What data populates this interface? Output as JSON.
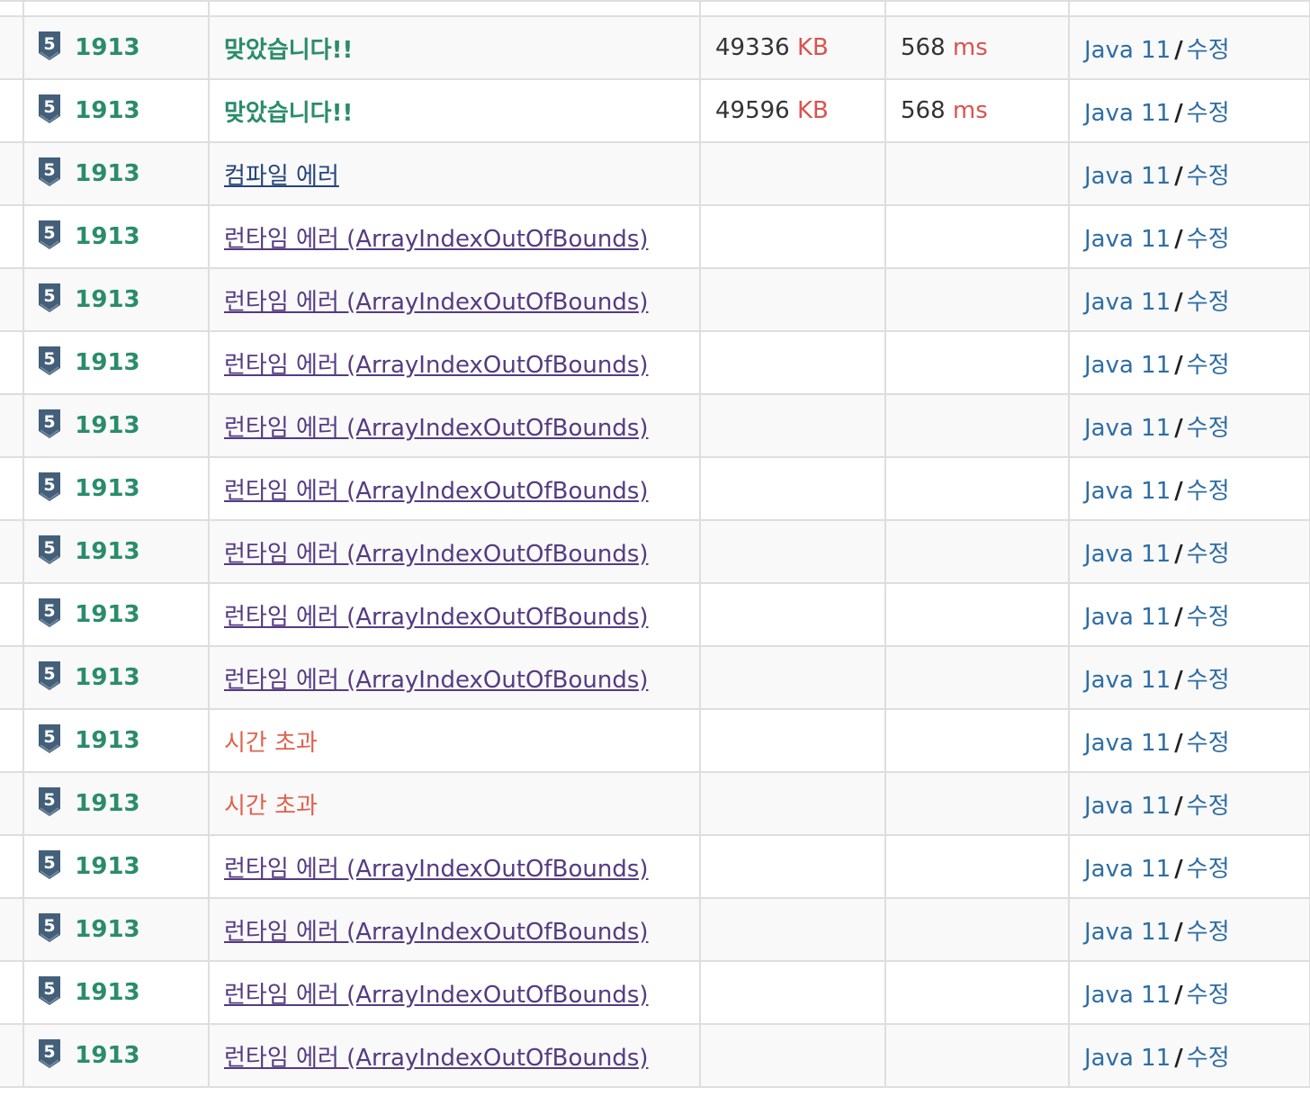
{
  "colors": {
    "accepted": "#2a8c6c",
    "link_purple": "#553b82",
    "compile_error": "#27457a",
    "time_limit": "#e0614e",
    "unit_red": "#d9534f",
    "lang_blue": "#2e6da4",
    "tier_icon": "#435f7a"
  },
  "rows": [
    {
      "tier": "5",
      "problem": "1913",
      "result": "맞았습니다!!",
      "result_type": "accepted",
      "memory": "49336",
      "memory_unit": "KB",
      "time": "568",
      "time_unit": "ms",
      "language": "Java 11",
      "separator": "/",
      "edit": "수정"
    },
    {
      "tier": "5",
      "problem": "1913",
      "result": "맞았습니다!!",
      "result_type": "accepted",
      "memory": "49596",
      "memory_unit": "KB",
      "time": "568",
      "time_unit": "ms",
      "language": "Java 11",
      "separator": "/",
      "edit": "수정"
    },
    {
      "tier": "5",
      "problem": "1913",
      "result": "컴파일 에러",
      "result_type": "compile-error",
      "memory": "",
      "memory_unit": "",
      "time": "",
      "time_unit": "",
      "language": "Java 11",
      "separator": "/",
      "edit": "수정"
    },
    {
      "tier": "5",
      "problem": "1913",
      "result": "런타임 에러 (ArrayIndexOutOfBounds)",
      "result_type": "runtime-error",
      "memory": "",
      "memory_unit": "",
      "time": "",
      "time_unit": "",
      "language": "Java 11",
      "separator": "/",
      "edit": "수정"
    },
    {
      "tier": "5",
      "problem": "1913",
      "result": "런타임 에러 (ArrayIndexOutOfBounds)",
      "result_type": "runtime-error",
      "memory": "",
      "memory_unit": "",
      "time": "",
      "time_unit": "",
      "language": "Java 11",
      "separator": "/",
      "edit": "수정"
    },
    {
      "tier": "5",
      "problem": "1913",
      "result": "런타임 에러 (ArrayIndexOutOfBounds)",
      "result_type": "runtime-error",
      "memory": "",
      "memory_unit": "",
      "time": "",
      "time_unit": "",
      "language": "Java 11",
      "separator": "/",
      "edit": "수정"
    },
    {
      "tier": "5",
      "problem": "1913",
      "result": "런타임 에러 (ArrayIndexOutOfBounds)",
      "result_type": "runtime-error",
      "memory": "",
      "memory_unit": "",
      "time": "",
      "time_unit": "",
      "language": "Java 11",
      "separator": "/",
      "edit": "수정"
    },
    {
      "tier": "5",
      "problem": "1913",
      "result": "런타임 에러 (ArrayIndexOutOfBounds)",
      "result_type": "runtime-error",
      "memory": "",
      "memory_unit": "",
      "time": "",
      "time_unit": "",
      "language": "Java 11",
      "separator": "/",
      "edit": "수정"
    },
    {
      "tier": "5",
      "problem": "1913",
      "result": "런타임 에러 (ArrayIndexOutOfBounds)",
      "result_type": "runtime-error",
      "memory": "",
      "memory_unit": "",
      "time": "",
      "time_unit": "",
      "language": "Java 11",
      "separator": "/",
      "edit": "수정"
    },
    {
      "tier": "5",
      "problem": "1913",
      "result": "런타임 에러 (ArrayIndexOutOfBounds)",
      "result_type": "runtime-error",
      "memory": "",
      "memory_unit": "",
      "time": "",
      "time_unit": "",
      "language": "Java 11",
      "separator": "/",
      "edit": "수정"
    },
    {
      "tier": "5",
      "problem": "1913",
      "result": "런타임 에러 (ArrayIndexOutOfBounds)",
      "result_type": "runtime-error",
      "memory": "",
      "memory_unit": "",
      "time": "",
      "time_unit": "",
      "language": "Java 11",
      "separator": "/",
      "edit": "수정"
    },
    {
      "tier": "5",
      "problem": "1913",
      "result": "시간 초과",
      "result_type": "time-limit",
      "memory": "",
      "memory_unit": "",
      "time": "",
      "time_unit": "",
      "language": "Java 11",
      "separator": "/",
      "edit": "수정"
    },
    {
      "tier": "5",
      "problem": "1913",
      "result": "시간 초과",
      "result_type": "time-limit",
      "memory": "",
      "memory_unit": "",
      "time": "",
      "time_unit": "",
      "language": "Java 11",
      "separator": "/",
      "edit": "수정"
    },
    {
      "tier": "5",
      "problem": "1913",
      "result": "런타임 에러 (ArrayIndexOutOfBounds)",
      "result_type": "runtime-error",
      "memory": "",
      "memory_unit": "",
      "time": "",
      "time_unit": "",
      "language": "Java 11",
      "separator": "/",
      "edit": "수정"
    },
    {
      "tier": "5",
      "problem": "1913",
      "result": "런타임 에러 (ArrayIndexOutOfBounds)",
      "result_type": "runtime-error",
      "memory": "",
      "memory_unit": "",
      "time": "",
      "time_unit": "",
      "language": "Java 11",
      "separator": "/",
      "edit": "수정"
    },
    {
      "tier": "5",
      "problem": "1913",
      "result": "런타임 에러 (ArrayIndexOutOfBounds)",
      "result_type": "runtime-error",
      "memory": "",
      "memory_unit": "",
      "time": "",
      "time_unit": "",
      "language": "Java 11",
      "separator": "/",
      "edit": "수정"
    },
    {
      "tier": "5",
      "problem": "1913",
      "result": "런타임 에러 (ArrayIndexOutOfBounds)",
      "result_type": "runtime-error",
      "memory": "",
      "memory_unit": "",
      "time": "",
      "time_unit": "",
      "language": "Java 11",
      "separator": "/",
      "edit": "수정"
    }
  ]
}
